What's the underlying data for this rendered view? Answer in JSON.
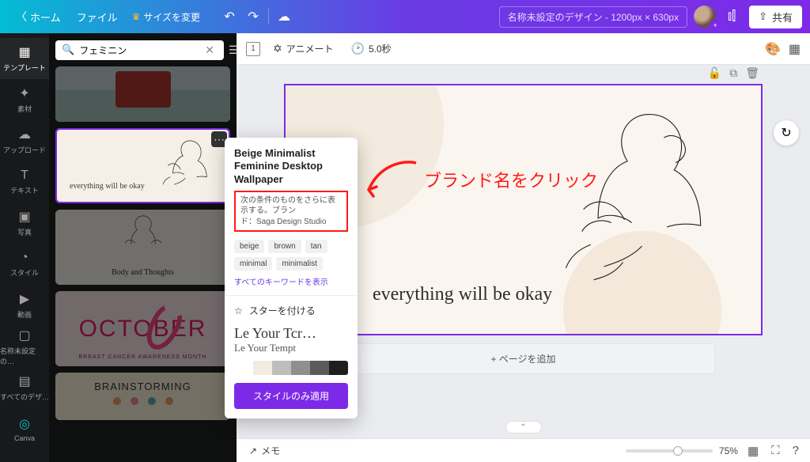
{
  "topbar": {
    "home": "ホーム",
    "file": "ファイル",
    "resize": "サイズを変更",
    "doc_title": "名称未設定のデザイン - 1200px × 630px",
    "share": "共有"
  },
  "rail": {
    "items": [
      {
        "label": "テンプレート"
      },
      {
        "label": "素材"
      },
      {
        "label": "アップロード"
      },
      {
        "label": "テキスト"
      },
      {
        "label": "写真"
      },
      {
        "label": "スタイル"
      },
      {
        "label": "動画"
      },
      {
        "label": "名称未設定の…"
      },
      {
        "label": "すべてのデザ…"
      },
      {
        "label": "Canva"
      }
    ]
  },
  "panel": {
    "search_value": "フェミニン",
    "thumb1_script": "everything will be okay",
    "thumb2_script": "Body and Thoughts",
    "thumb3_word": "OCTOBER",
    "thumb3_sub": "BREAST CANCER AWARENESS MONTH",
    "thumb4_title": "BRAINSTORMING"
  },
  "popover": {
    "title": "Beige Minimalist Feminine Desktop Wallpaper",
    "brand_line1": "次の条件のものをさらに表示する。ブラン",
    "brand_line2": "ド：Saga Design Studio",
    "tags": [
      "beige",
      "brown",
      "tan",
      "minimal",
      "minimalist"
    ],
    "all_tags": "すべてのキーワードを表示",
    "star": "スターを付ける",
    "font_preview_1": "Le Your Tcr…",
    "font_preview_2": "Le Your Tempt",
    "palette": [
      "#ffffff",
      "#f1ebe2",
      "#bdbdbd",
      "#8f8f8f",
      "#5b5b5b",
      "#1f1f1f"
    ],
    "apply": "スタイルのみ適用"
  },
  "stage": {
    "page_num": "1",
    "animate": "アニメート",
    "duration": "5.0秒",
    "quote": "everything will be okay",
    "add_page": "+ ページを追加"
  },
  "bottombar": {
    "notes": "メモ",
    "zoom_pct": "75%"
  },
  "annotation": "ブランド名をクリック"
}
